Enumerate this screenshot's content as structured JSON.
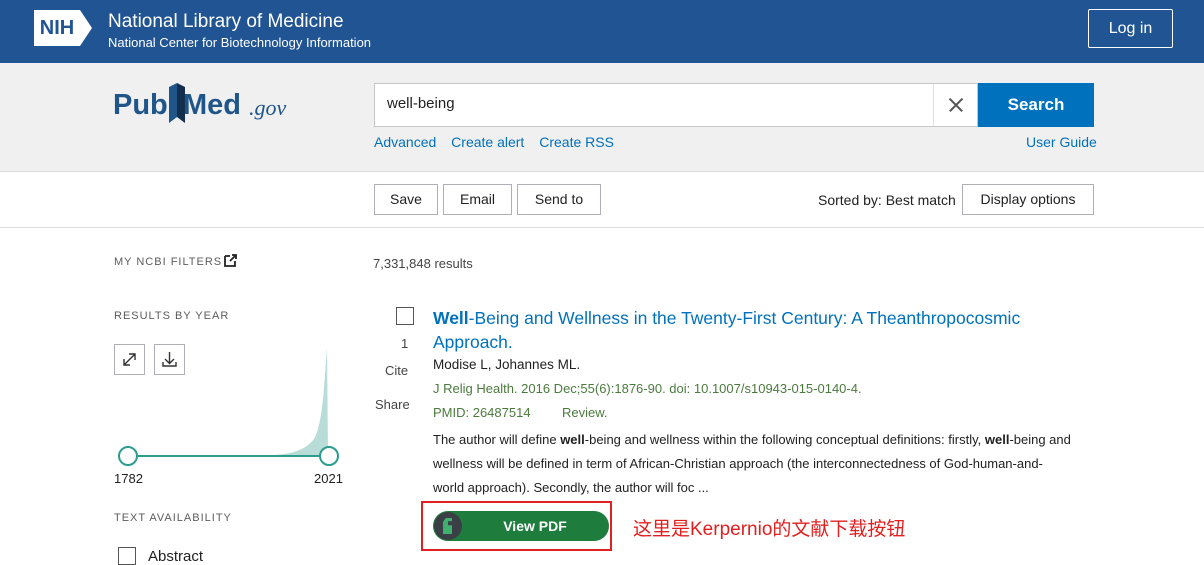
{
  "header": {
    "logo_text": "NIH",
    "title": "National Library of Medicine",
    "subtitle": "National Center for Biotechnology Information",
    "login_label": "Log in"
  },
  "search": {
    "logo_pub": "Pub",
    "logo_med": "Med",
    "logo_gov": ".gov",
    "value": "well-being",
    "button_label": "Search",
    "links": [
      "Advanced",
      "Create alert",
      "Create RSS"
    ],
    "user_guide": "User Guide"
  },
  "actions": {
    "save": "Save",
    "email": "Email",
    "send_to": "Send to",
    "sorted_by": "Sorted by: Best match",
    "display_options": "Display options"
  },
  "sidebar": {
    "my_filters": "MY NCBI FILTERS",
    "results_by_year": "RESULTS BY YEAR",
    "year_start": "1782",
    "year_end": "2021",
    "text_availability": "TEXT AVAILABILITY",
    "filters": [
      "Abstract"
    ]
  },
  "results": {
    "count": "7,331,848 results",
    "items": [
      {
        "number": "1",
        "cite": "Cite",
        "share": "Share",
        "title_bold": "Well",
        "title_rest": "-Being and Wellness in the Twenty-First Century: A Theanthropocosmic Approach.",
        "authors": "Modise L, Johannes ML.",
        "citation": "J Relig Health. 2016 Dec;55(6):1876-90. doi: 10.1007/s10943-015-0140-4.",
        "pmid": "PMID: 26487514",
        "type": "Review.",
        "abstract_1": "The author will define ",
        "abstract_b1": "well",
        "abstract_2": "-being and wellness within the following conceptual definitions: firstly, ",
        "abstract_b2": "well",
        "abstract_3": "-being and wellness will be defined in term of African-Christian approach (the interconnectedness of God-human-and-world approach). Secondly, the author will foc ...",
        "pdf_button": "View PDF"
      }
    ]
  },
  "annotation": "这里是Kerpernio的文献下载按钮",
  "colors": {
    "header_bg": "#205493",
    "link": "#0071bc",
    "search_button": "#0071bc",
    "journal_text": "#4b7a3d",
    "pdf_button": "#1e7d3c",
    "annotation_red": "#e02020",
    "chart_fill": "#b8dcd8",
    "chart_slider": "#2a9d8f"
  }
}
